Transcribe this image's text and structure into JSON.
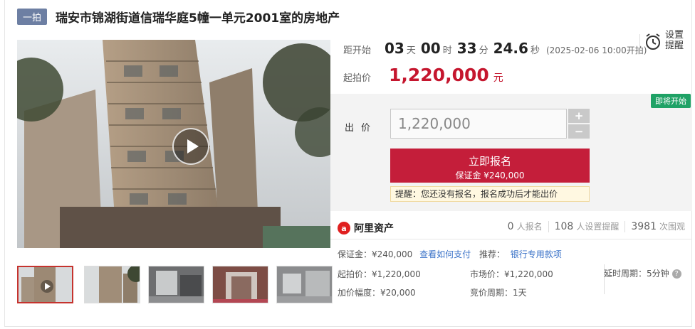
{
  "header": {
    "badge": "一拍",
    "title": "瑞安市锦湖街道信瑞华庭5幢一单元2001室的房地产"
  },
  "countdown": {
    "label": "距开始",
    "days": "03",
    "days_unit": "天",
    "hours": "00",
    "hours_unit": "时",
    "minutes": "33",
    "minutes_unit": "分",
    "seconds": "24.6",
    "seconds_unit": "秒",
    "start_note": "(2025-02-06 10:00开拍)"
  },
  "reminder": {
    "label": "设置提醒",
    "icon": "alarm-clock-icon"
  },
  "start_price": {
    "label": "起拍价",
    "value": "1,220,000",
    "unit": "元"
  },
  "bid": {
    "status_tag": "即将开始",
    "label": "出价",
    "input_value": "1,220,000",
    "plus": "+",
    "minus": "−",
    "signup_label": "立即报名",
    "deposit_note": "保证金 ¥240,000",
    "notice": "提醒：您还没有报名，报名成功后才能出价"
  },
  "brand": {
    "logo_letter": "a",
    "name": "阿里资产"
  },
  "stats": {
    "signups": "0",
    "signups_label": "人报名",
    "reminders": "108",
    "reminders_label": "人设置提醒",
    "views": "3981",
    "views_label": "次围观"
  },
  "details": {
    "deposit": "保证金：¥240,000",
    "how_to_pay": "查看如何支付",
    "recommend_label": "推荐：",
    "bank_link": "银行专用款项",
    "start_price": "起拍价：¥1,220,000",
    "market_price": "市场价：¥1,220,000",
    "delay_period": "延时周期：5分钟",
    "increment": "加价幅度：¥20,000",
    "bid_period": "竞价周期：1天"
  },
  "colors": {
    "accent_red": "#c41e3a",
    "badge_blue": "#6d7fa3",
    "status_green": "#1fa266",
    "link_blue": "#3b73c8"
  }
}
